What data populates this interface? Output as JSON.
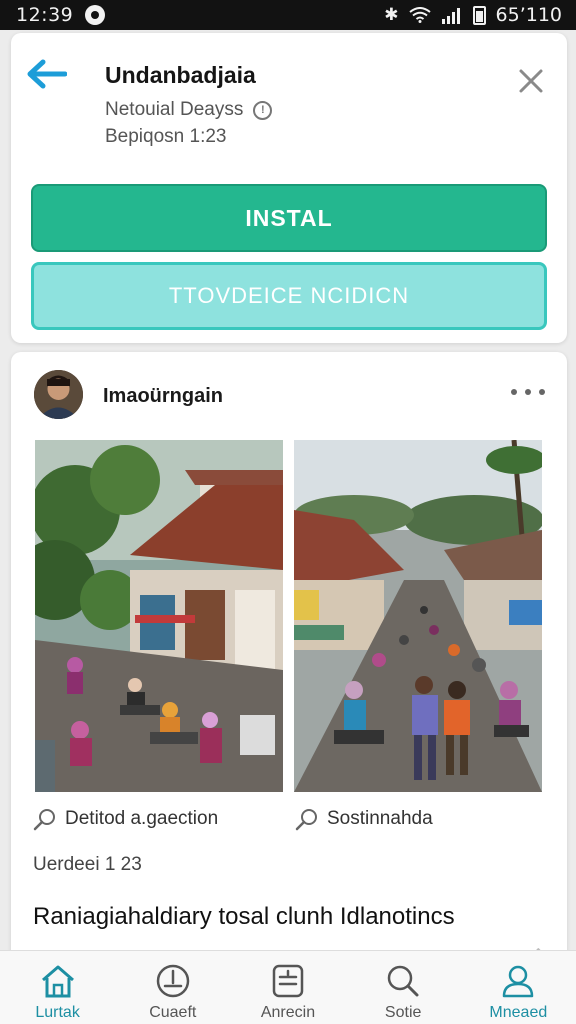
{
  "status_bar": {
    "time": "12:39",
    "right_text": "65’110"
  },
  "app": {
    "title": "Undanbadjaia",
    "subtitle": "Netouial Deayss",
    "meta": "Bepiqosn 1:23",
    "install_label": "INSTAL",
    "secondary_label": "TTOVDEICE NCIDICN"
  },
  "post": {
    "author": "Imaoürngain",
    "captions": [
      "Detitod a.gaection",
      "Sostinnahda"
    ],
    "meta": "Uerdeei 1 23",
    "body": "Raniagiahaldiary tosal clunh Idlanotincs"
  },
  "bottom_nav": {
    "items": [
      {
        "label": "Lurtak",
        "icon": "home-icon"
      },
      {
        "label": "Cuaeft",
        "icon": "download-icon"
      },
      {
        "label": "Anrecin",
        "icon": "list-icon"
      },
      {
        "label": "Sotie",
        "icon": "search-icon"
      },
      {
        "label": "Mneaed",
        "icon": "profile-icon"
      }
    ],
    "active_index": 4
  },
  "colors": {
    "install": "#24b78f",
    "secondary": "#8ee2de",
    "accent": "#1d8fa3"
  }
}
